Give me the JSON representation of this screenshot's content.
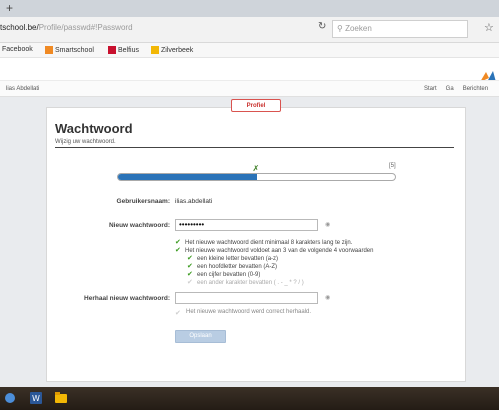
{
  "browser": {
    "new_tab": "+",
    "url_host": "tschool.be/",
    "url_path": "Profile/passwd#!Password",
    "search_placeholder": "Zoeken",
    "bookmarks": [
      {
        "label": "Facebook",
        "color": "#3b5998"
      },
      {
        "label": "Smartschool",
        "color": "#f08a24"
      },
      {
        "label": "Belfius",
        "color": "#c8102e"
      },
      {
        "label": "Zilverbeek",
        "color": "#f2b705"
      }
    ]
  },
  "site": {
    "user": "lias Abdellati",
    "nav": [
      "Start",
      "Ga",
      "Berichten"
    ]
  },
  "profile_tab": "Profiel",
  "page": {
    "title": "Wachtwoord",
    "subtitle": "Wijzig uw wachtwoord.",
    "strength": {
      "level": 0.5,
      "end_marker": "[5]"
    },
    "username_label": "Gebruikersnaam:",
    "username_value": "ilias.abdellati",
    "new_password_label": "Nieuw wachtwoord:",
    "new_password_value": "•••••••••",
    "rules": [
      {
        "text": "Het nieuwe wachtwoord dient minimaal 8 karakters lang te zijn.",
        "ok": true,
        "sub": false
      },
      {
        "text": "Het nieuwe wachtwoord voldoet aan 3 van de volgende 4 voorwaarden",
        "ok": true,
        "sub": false
      },
      {
        "text": "een kleine letter bevatten (a-z)",
        "ok": true,
        "sub": true
      },
      {
        "text": "een hoofdletter bevatten (A-Z)",
        "ok": true,
        "sub": true
      },
      {
        "text": "een cijfer bevatten (0-9)",
        "ok": true,
        "sub": true
      },
      {
        "text": "een ander karakter bevatten ( . - _ * ? / )",
        "ok": false,
        "sub": true
      }
    ],
    "repeat_label": "Herhaal nieuw wachtwoord:",
    "repeat_value": "",
    "repeat_message": "Het nieuwe wachtwoord werd correct herhaald.",
    "submit_label": "Opslaan"
  },
  "colors": {
    "accent": "#2a73b8",
    "check": "#3a9a1f",
    "profile_tab": "#c9302c"
  }
}
